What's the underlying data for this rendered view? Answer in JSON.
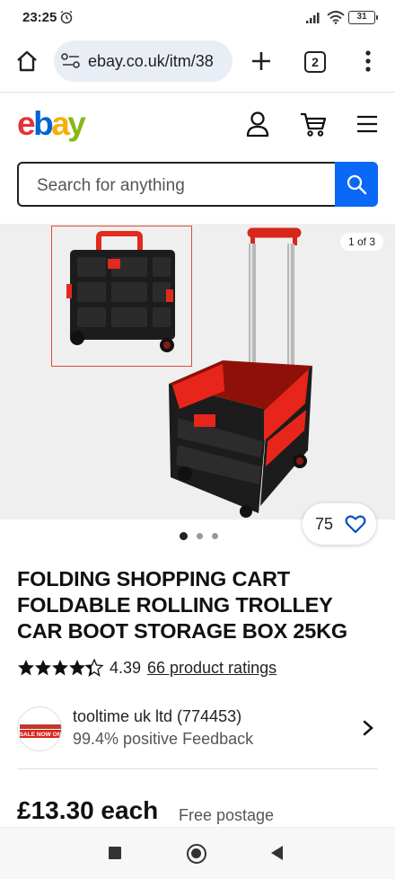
{
  "status_bar": {
    "time": "23:25",
    "battery": "31",
    "icons": [
      "alarm-icon",
      "signal-icon",
      "wifi-icon",
      "battery-icon"
    ]
  },
  "browser": {
    "url": "ebay.co.uk/itm/38",
    "tab_count": "2",
    "icons": [
      "home-icon",
      "site-settings-icon",
      "plus-icon",
      "tabs-icon",
      "more-vert-icon"
    ]
  },
  "ebay_header": {
    "logo_letters": [
      "e",
      "b",
      "a",
      "y"
    ],
    "logo_colors": [
      "#e53238",
      "#0064d2",
      "#f5af02",
      "#86b817"
    ],
    "icons": [
      "account-icon",
      "cart-icon",
      "hamburger-icon"
    ]
  },
  "search": {
    "placeholder": "Search for anything",
    "button_color": "#0968f6"
  },
  "gallery": {
    "counter": "1 of 3",
    "dots": 3,
    "active_dot": 0,
    "watch_count": "75"
  },
  "item": {
    "title": "FOLDING SHOPPING CART FOLDABLE ROLLING TROLLEY CAR BOOT STORAGE BOX 25KG",
    "rating_value": "4.39",
    "rating_stars": 4.39,
    "ratings_link": "66 product ratings"
  },
  "seller": {
    "name": "tooltime uk ltd (774453)",
    "feedback": "99.4% positive Feedback",
    "avatar_text": "SALE NOW ON"
  },
  "price": {
    "amount": "£13.30 each",
    "postage": "Free postage"
  }
}
